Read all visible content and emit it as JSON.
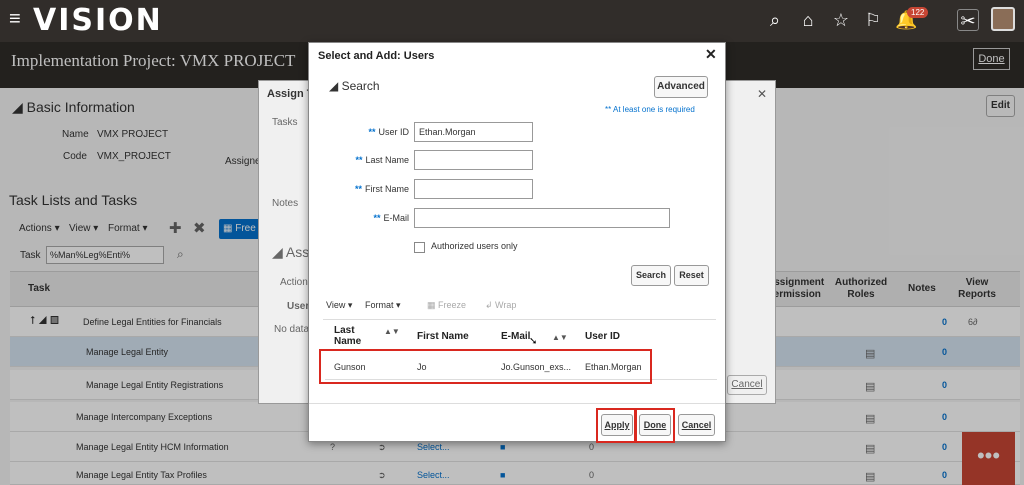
{
  "app": {
    "logo": "VISION",
    "badge_count": "122"
  },
  "page": {
    "title": "Implementation Project: VMX PROJECT",
    "done_label": "Done"
  },
  "basic_info": {
    "heading": "Basic Information",
    "name_label": "Name",
    "name_value": "VMX PROJECT",
    "code_label": "Code",
    "code_value": "VMX_PROJECT",
    "edit_label": "Edit"
  },
  "tasks": {
    "heading": "Task Lists and Tasks",
    "actions_label": "Actions",
    "view_label": "View",
    "format_label": "Format",
    "freeze_label": "Free",
    "task_label": "Task",
    "task_filter": "%Man%Leg%Enti%",
    "columns": [
      "Task",
      "Assignment Permission",
      "Authorized Roles",
      "Notes",
      "View Reports"
    ],
    "rows": [
      {
        "name": "Define Legal Entities for Financials",
        "notes": "0"
      },
      {
        "name": "Manage Legal Entity",
        "notes": "0"
      },
      {
        "name": "Manage Legal Entity Registrations",
        "notes": "0"
      },
      {
        "name": "Manage Intercompany Exceptions",
        "notes": "0"
      },
      {
        "name": "Manage Legal Entity HCM Information",
        "notes": "0",
        "select": "Select...",
        "count": "0"
      },
      {
        "name": "Manage Legal Entity Tax Profiles",
        "notes": "0",
        "select": "Select...",
        "count": "0"
      }
    ]
  },
  "bg_dialog": {
    "title": "Assign T",
    "tasks_label": "Tasks",
    "notes_label": "Notes",
    "assign_heading": "Ass",
    "actions_label": "Actions",
    "user_col": "User",
    "no_data": "No data",
    "assignee": "Assigne",
    "cancel": "Cancel"
  },
  "dialog": {
    "title": "Select and Add: Users",
    "search_heading": "Search",
    "advanced_label": "Advanced",
    "required_note": "** At least one is required",
    "fields": {
      "user_id_label": "User ID",
      "user_id_value": "Ethan.Morgan",
      "last_name_label": "Last Name",
      "last_name_value": "",
      "first_name_label": "First Name",
      "first_name_value": "",
      "email_label": "E-Mail",
      "email_value": ""
    },
    "required_marker": "**",
    "authorized_only": "Authorized users only",
    "search_btn": "Search",
    "reset_btn": "Reset",
    "toolbar": {
      "view": "View",
      "format": "Format",
      "freeze": "Freeze",
      "wrap": "Wrap"
    },
    "columns": {
      "last": "Last Name",
      "first": "First Name",
      "email": "E-Mail",
      "userid": "User ID"
    },
    "results": [
      {
        "last": "Gunson",
        "first": "Jo",
        "email": "Jo.Gunson_exs...",
        "userid": "Ethan.Morgan"
      }
    ],
    "apply_btn": "Apply",
    "done_btn": "Done",
    "cancel_btn": "Cancel"
  }
}
